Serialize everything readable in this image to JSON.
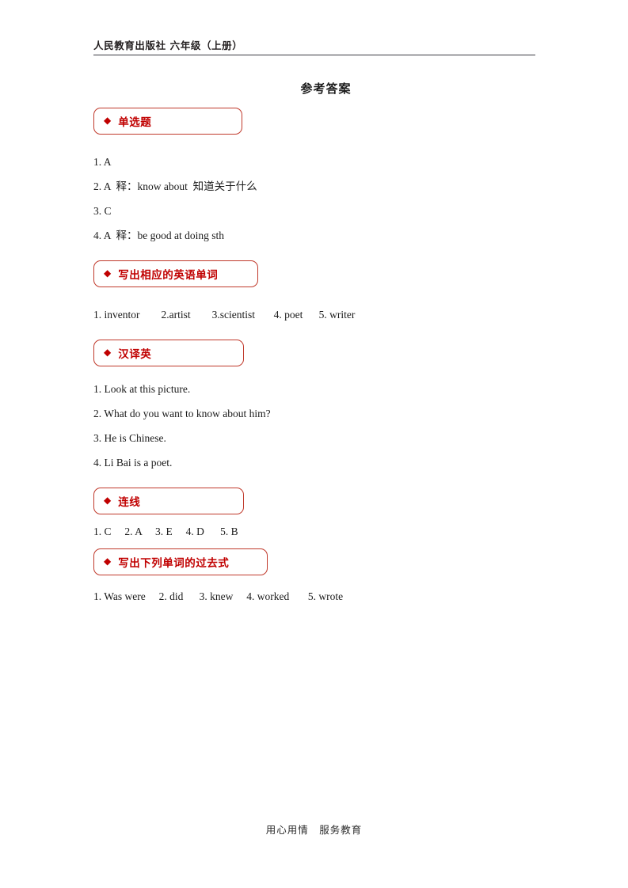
{
  "header": {
    "text": "人民教育出版社 六年级（上册）"
  },
  "title": "参考答案",
  "icons": {
    "diamond": "◆"
  },
  "colors": {
    "accent_red": "#c00000",
    "border_red": "#c0392b",
    "text": "#1a1a1a"
  },
  "sections": [
    {
      "label": "单选题",
      "answers": [
        "1. A",
        "2. A  释：know about  知道关于什么",
        "3. C",
        "4. A  释：be good at doing sth"
      ]
    },
    {
      "label": "写出相应的英语单词",
      "answers": [
        "1. inventor        2.artist        3.scientist       4. poet      5. writer"
      ]
    },
    {
      "label": "汉译英",
      "answers": [
        "1. Look at this picture.",
        "2. What do you want to know about him?",
        "3. He is Chinese.",
        "4. Li Bai is a poet."
      ]
    },
    {
      "label": "连线",
      "answers": [
        "1. C     2. A     3. E     4. D      5. B"
      ]
    },
    {
      "label": "写出下列单词的过去式",
      "answers": [
        "1. Was were     2. did      3. knew     4. worked       5. wrote"
      ]
    }
  ],
  "footer": {
    "text": "用心用情　服务教育"
  }
}
